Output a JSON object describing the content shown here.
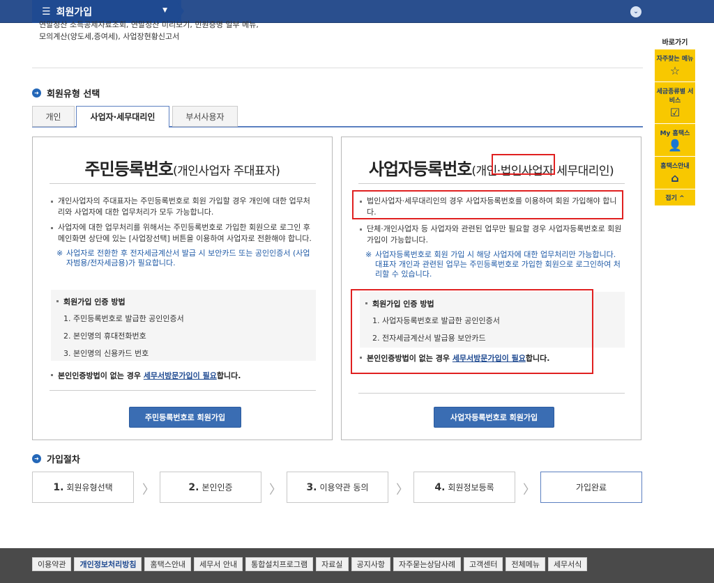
{
  "header": {
    "menu_label": "회원가입"
  },
  "intro_lines": [
    "연말정산 소득공제자료조회, 연말정산 미리보기, 민원증명 일부 메뉴,",
    "모의계산(양도세,증여세), 사업장현황신고서"
  ],
  "member_type": {
    "section_title": "회원유형 선택",
    "tabs": [
      {
        "label": "개인"
      },
      {
        "label": "사업자·세무대리인"
      },
      {
        "label": "부서사용자"
      }
    ]
  },
  "left_panel": {
    "title_main": "주민등록번호",
    "title_sub": "(개인사업자 주대표자)",
    "items": [
      "개인사업자의 주대표자는 주민등록번호로 회원 가입할 경우 개인에 대한 업무처리와 사업자에 대한 업무처리가 모두 가능합니다.",
      "사업자에 대한 업무처리를 위해서는 주민등록번호로 가입한 회원으로 로그인 후 메인화면 상단에 있는 [사업장선택] 버튼을 이용하여 사업자로 전환해야 합니다."
    ],
    "note": "사업자로 전환한 후 전자세금계산서 발급 시 보안카드 또는 공인인증서 (사업자범용/전자세금용)가 필요합니다.",
    "auth_title": "회원가입 인증 방법",
    "auth_steps": [
      "1. 주민등록번호로 발급한 공인인증서",
      "2. 본인명의 휴대전화번호",
      "3. 본인명의 신용카드 번호"
    ],
    "noauth_prefix": "본인인증방법이 없는 경우 ",
    "noauth_link": "세무서방문가입이 필요",
    "noauth_suffix": "합니다.",
    "button": "주민등록번호로 회원가입"
  },
  "right_panel": {
    "title_main": "사업자등록번호",
    "title_sub": "(개인·법인사업자 세무대리인)",
    "items": [
      "법인사업자·세무대리인의 경우 사업자등록번호를 이용하여 회원 가입해야 합니다.",
      "단체·개인사업자 등 사업자와 관련된 업무만 필요할 경우 사업자등록번호로 회원가입이 가능합니다."
    ],
    "note": "사업자등록번호로 회원 가입 시 해당 사업자에 대한 업무처리만 가능합니다. 대표자 개인과 관련된 업무는 주민등록번호로 가입한 회원으로 로그인하여 처리할 수 있습니다.",
    "auth_title": "회원가입 인증 방법",
    "auth_steps": [
      "1. 사업자등록번호로 발급한 공인인증서",
      "2. 전자세금계산서 발급용 보안카드"
    ],
    "noauth_prefix": "본인인증방법이 없는 경우 ",
    "noauth_link": "세무서방문가입이 필요",
    "noauth_suffix": "합니다.",
    "button": "사업자등록번호로 회원가입"
  },
  "procedure": {
    "section_title": "가입절차",
    "steps": [
      {
        "num": "1.",
        "label": "회원유형선택"
      },
      {
        "num": "2.",
        "label": "본인인증"
      },
      {
        "num": "3.",
        "label": "이용약관 동의"
      },
      {
        "num": "4.",
        "label": "회원정보등록"
      },
      {
        "num": "",
        "label": "가입완료"
      }
    ]
  },
  "footer": {
    "links": [
      "이용약관",
      "개인정보처리방침",
      "홈택스안내",
      "세무서 안내",
      "통합설치프로그램",
      "자료실",
      "공지사항",
      "자주묻는상담사례",
      "고객센터",
      "전체메뉴",
      "세무서식"
    ]
  },
  "quick_bar": {
    "label": "바로가기",
    "items": [
      "자주찾는 메뉴",
      "세금종류별 서비스",
      "My 홈택스",
      "홈택스안내"
    ],
    "fold": "접기 ^"
  },
  "colors": {
    "header": "#2a4f8e",
    "accent": "#3a6db3",
    "highlight": "#e02020",
    "quick_bar": "#f8c800"
  }
}
